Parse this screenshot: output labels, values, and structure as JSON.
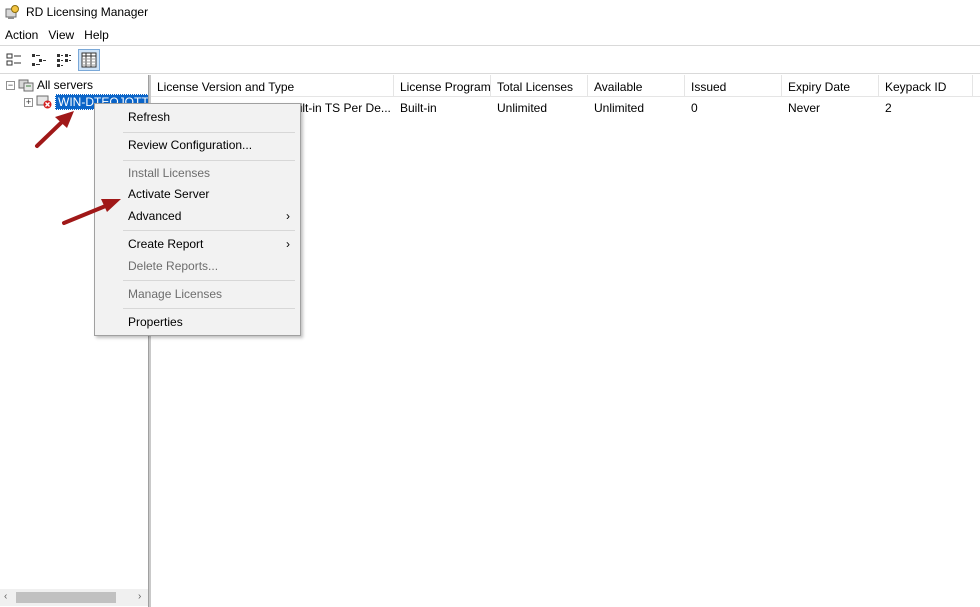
{
  "window": {
    "title": "RD Licensing Manager"
  },
  "menubar": {
    "items": [
      "Action",
      "View",
      "Help"
    ]
  },
  "tree": {
    "root_label": "All servers",
    "server_label": "WIN-DTEQJOTT",
    "root_expander": "−",
    "server_expander": "+"
  },
  "list": {
    "columns": [
      "License Version and Type",
      "License Program",
      "Total Licenses",
      "Available",
      "Issued",
      "Expiry Date",
      "Keypack ID"
    ],
    "rows": [
      [
        "Windows 2000 Server - Built-in TS Per De...",
        "Built-in",
        "Unlimited",
        "Unlimited",
        "0",
        "Never",
        "2"
      ]
    ]
  },
  "context_menu": {
    "refresh": "Refresh",
    "review": "Review Configuration...",
    "install": "Install Licenses",
    "activate": "Activate Server",
    "advanced": "Advanced",
    "create_report": "Create Report",
    "delete_reports": "Delete Reports...",
    "manage": "Manage Licenses",
    "properties": "Properties",
    "submenu_arrow": "›"
  },
  "scrollbar": {
    "left_arrow": "‹",
    "right_arrow": "›"
  },
  "colors": {
    "selection": "#0a64c8",
    "annotation_arrow": "#a01818",
    "error_badge": "#d42020"
  },
  "icons": [
    "licensing-app-icon",
    "server-tree-icon",
    "server-error-icon",
    "tree-view-icon",
    "detail-view-icon"
  ]
}
